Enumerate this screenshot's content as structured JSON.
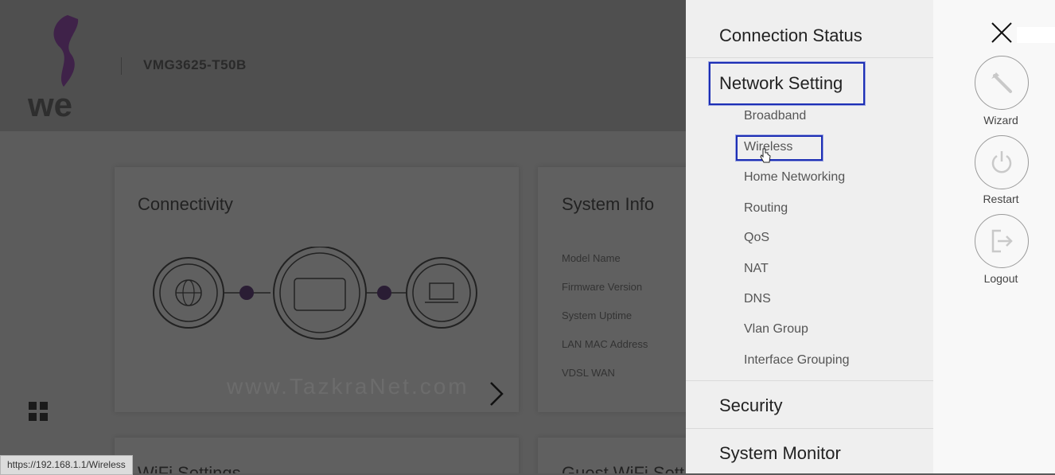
{
  "background": {
    "model": "VMG3625-T50B",
    "connectivity_title": "Connectivity",
    "system_info_title": "System Info",
    "system_info_labels": [
      "Model Name",
      "Firmware Version",
      "System Uptime",
      "LAN MAC Address",
      "VDSL WAN"
    ],
    "wifi_settings_title": "WiFi Settings",
    "guest_wifi_title": "Guest WiFi Sett",
    "watermark": "www.TazkraNet.com"
  },
  "status_url": "https://192.168.1.1/Wireless",
  "menu": {
    "connection_status": "Connection Status",
    "network_setting": "Network Setting",
    "network_items": [
      "Broadband",
      "Wireless",
      "Home Networking",
      "Routing",
      "QoS",
      "NAT",
      "DNS",
      "Vlan Group",
      "Interface Grouping"
    ],
    "security": "Security",
    "system_monitor": "System Monitor"
  },
  "actions": {
    "wizard": "Wizard",
    "restart": "Restart",
    "logout": "Logout"
  },
  "colors": {
    "highlight": "#1d2fb5",
    "brand_purple": "#6a2a7a"
  }
}
